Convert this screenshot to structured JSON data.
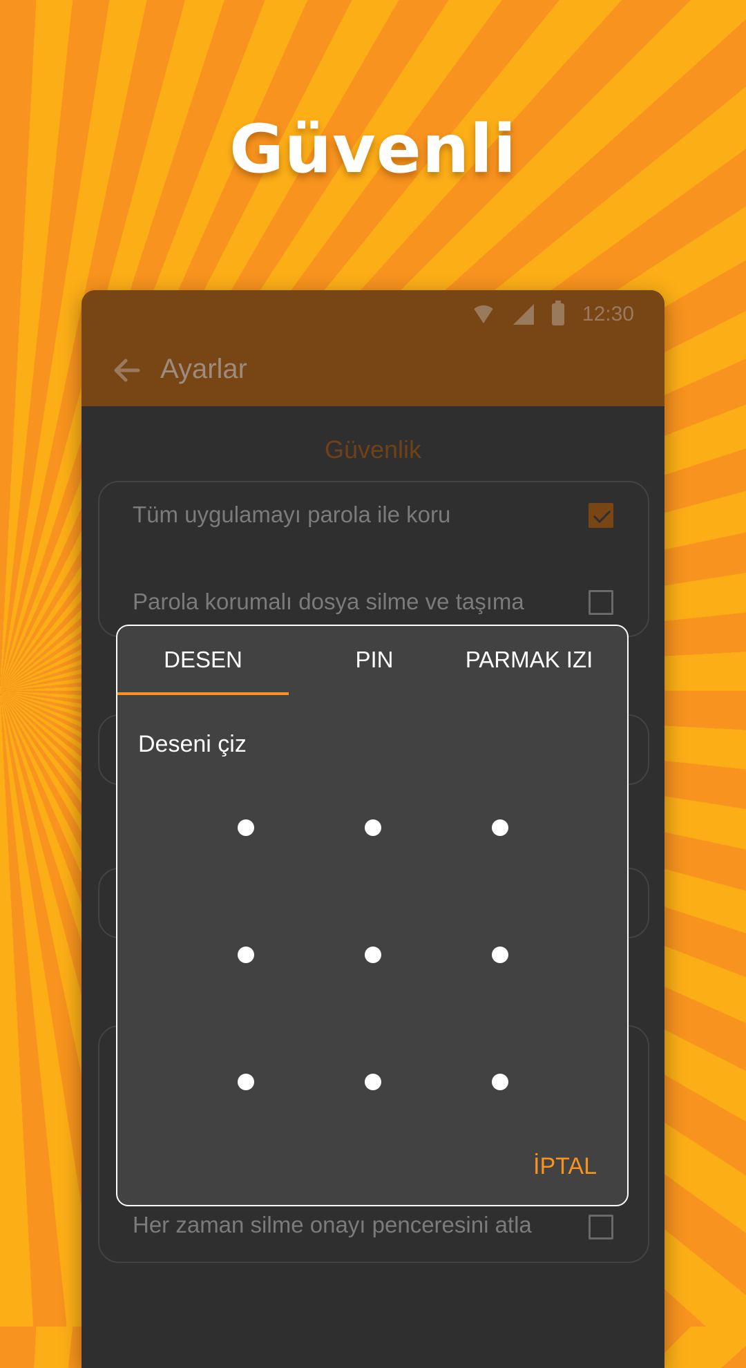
{
  "headline": "Güvenli",
  "status_bar": {
    "time": "12:30",
    "icons": [
      "wifi-icon",
      "signal-icon",
      "battery-icon"
    ]
  },
  "app_bar": {
    "title": "Ayarlar",
    "back_icon": "arrow-left-icon"
  },
  "section": {
    "title": "Güvenlik"
  },
  "settings": [
    {
      "label": "Tüm uygulamayı parola ile koru",
      "checked": true
    },
    {
      "label": "Parola korumalı dosya silme ve taşıma",
      "checked": false
    },
    {
      "label": "Her zaman silme onayı penceresini atla",
      "checked": false
    }
  ],
  "dialog": {
    "tabs": [
      "DESEN",
      "PIN",
      "PARMAK IZI"
    ],
    "active_tab": "DESEN",
    "prompt": "Deseni çiz",
    "cancel_label": "İPTAL"
  },
  "colors": {
    "accent": "#f7931e",
    "app_bar": "#784515",
    "background": "#302f30",
    "dialog": "#424242"
  }
}
